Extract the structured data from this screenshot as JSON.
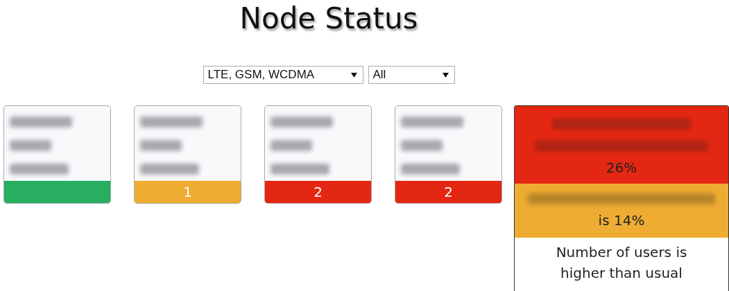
{
  "title": "Node Status",
  "filters": [
    {
      "value": "LTE, GSM, WCDMA"
    },
    {
      "value": "All"
    }
  ],
  "nodes": [
    {
      "color": "#27ae60"
    },
    {
      "color": "#eeac32",
      "count": "1"
    },
    {
      "color": "#e42712",
      "count": "2"
    },
    {
      "color": "#e42712",
      "count": "2"
    }
  ],
  "alerts": [
    {
      "color": "#e42712",
      "text": "26%"
    },
    {
      "color": "#eeac32",
      "text": "is 14%"
    },
    {
      "color": "#ffffff",
      "text": "Number of users is higher than usual"
    }
  ]
}
